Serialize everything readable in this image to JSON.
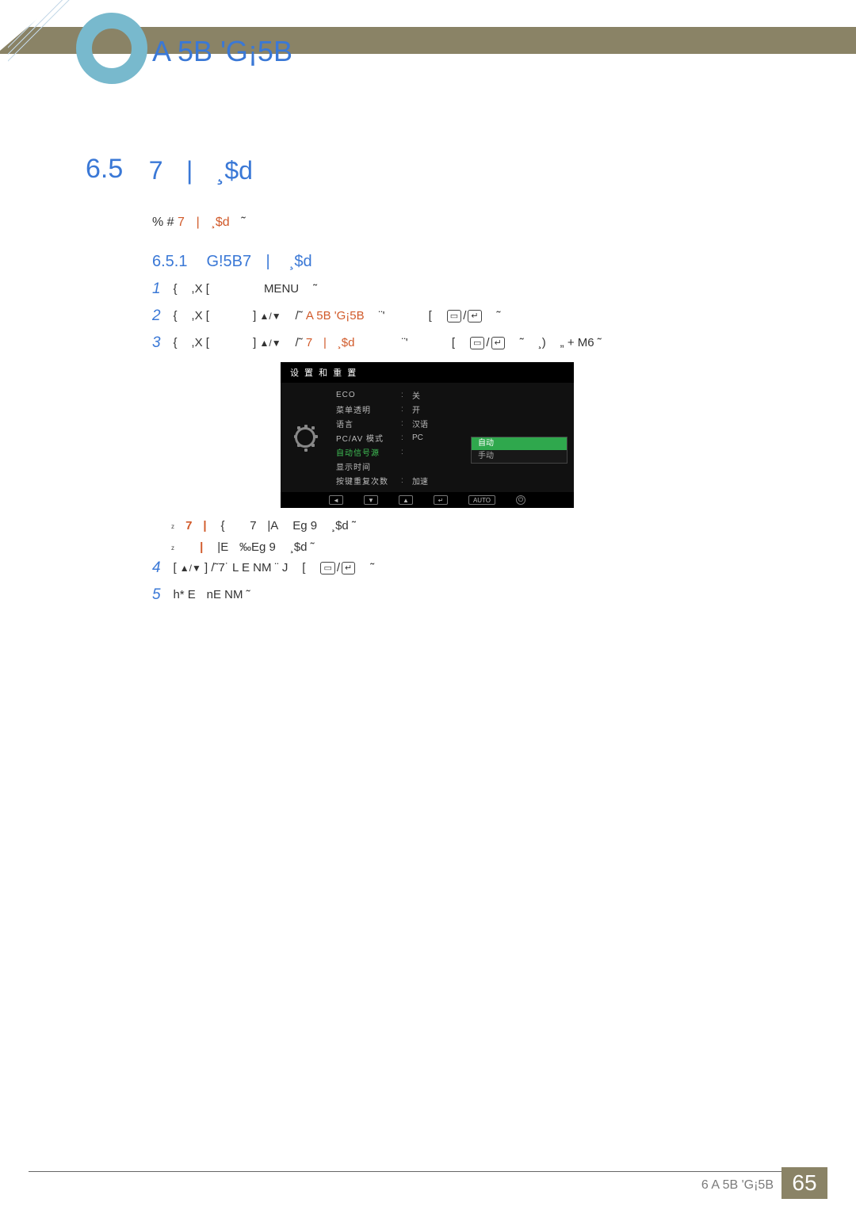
{
  "header": {
    "title": "A 5B 'G¡5B"
  },
  "section": {
    "number": "6.5",
    "title": "7ﾠ|ﾠ¸$d"
  },
  "intro": {
    "prefix": "% # ",
    "highlight": "7ﾠ|ﾠ¸$d",
    "suffix": "ﾠ˜"
  },
  "subsection": {
    "label": "6.5.1ﾠ G!5B7ﾠ|ﾠ ¸$d"
  },
  "steps": [
    {
      "num": "1",
      "pre": "{ﾠ  ,X [ﾠﾠﾠﾠﾠMENU ﾠ˜"
    },
    {
      "num": "2",
      "pre": "{ﾠ  ,X [ﾠﾠﾠﾠ] ",
      "arrows": true,
      "mid1": " ﾠ/˜ ",
      "hl": "A 5B 'G¡5B",
      "mid2": "ﾠ  ¨'ﾠﾠﾠﾠ[ﾠ ",
      "btn": true,
      "tail": " ﾠ˜"
    },
    {
      "num": "3",
      "pre": "{ﾠ  ,X [ﾠﾠﾠﾠ] ",
      "arrows": true,
      "mid1": " ﾠ/˜ ",
      "hl": "7ﾠ|ﾠ¸$d",
      "mid2": "ﾠﾠﾠﾠ ¨'ﾠﾠﾠﾠ[ﾠ ",
      "btn": true,
      "tail": " ﾠ˜ ﾠ¸) ﾠ„ + M6 ˜"
    }
  ],
  "osd": {
    "header": "设 置 和 重 置",
    "rows": [
      {
        "label": "ECO",
        "value": "关"
      },
      {
        "label": "菜单透明",
        "value": "开"
      },
      {
        "label": "语言",
        "value": "汉语"
      },
      {
        "label": "PC/AV 模式",
        "value": "PC"
      },
      {
        "label": "自动信号源",
        "value": "",
        "active": true
      },
      {
        "label": "显示时间",
        "value": ""
      },
      {
        "label": "按键重复次数",
        "value": "加速"
      }
    ],
    "dropdown": {
      "options": [
        "自动",
        "手动"
      ],
      "selected": 0
    },
    "footer": [
      "◄",
      "▼",
      "▲",
      "↵",
      "AUTO",
      "⏻"
    ]
  },
  "bullets": [
    {
      "hl": "7ﾠ|",
      "rest": "ﾠ  {ﾠﾠ 7ﾠ|Aﾠ Eg 9ﾠ ¸$d ˜"
    },
    {
      "hl": "ﾠ |",
      "rest": "ﾠ  |Eﾠ‰Eg 9ﾠ ¸$d ˜"
    }
  ],
  "steps2": [
    {
      "num": "4",
      "pre": "[ ",
      "arrows": true,
      "mid": " ] /˜7˙ L E NM ¨ J ﾠ[ﾠ ",
      "btn": true,
      "tail": " ﾠ˜"
    },
    {
      "num": "5",
      "pre": "h* EﾠnE NM ˜"
    }
  ],
  "footer": {
    "text": "6 A 5B 'G¡5B",
    "page": "65"
  }
}
